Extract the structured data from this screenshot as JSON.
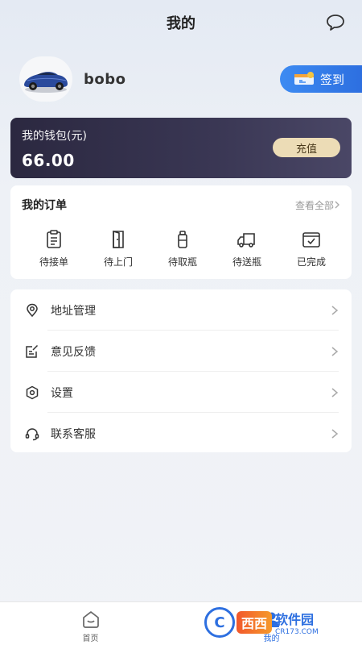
{
  "header": {
    "title": "我的",
    "message_icon": "chat-bubble-icon"
  },
  "profile": {
    "username": "bobo",
    "avatar": "car-avatar"
  },
  "checkin": {
    "label": "签到",
    "icon": "ticket-icon"
  },
  "wallet": {
    "label": "我的钱包(元)",
    "amount": "66.00",
    "recharge_label": "充值"
  },
  "orders": {
    "title": "我的订单",
    "view_all": "查看全部",
    "items": [
      {
        "label": "待接单",
        "icon": "clipboard-icon"
      },
      {
        "label": "待上门",
        "icon": "door-icon"
      },
      {
        "label": "待取瓶",
        "icon": "bottle-icon"
      },
      {
        "label": "待送瓶",
        "icon": "truck-icon"
      },
      {
        "label": "已完成",
        "icon": "check-box-icon"
      }
    ]
  },
  "menu": [
    {
      "label": "地址管理",
      "icon": "location-pin-icon"
    },
    {
      "label": "意见反馈",
      "icon": "feedback-icon"
    },
    {
      "label": "设置",
      "icon": "settings-icon"
    },
    {
      "label": "联系客服",
      "icon": "headset-icon"
    }
  ],
  "tabbar": {
    "tabs": [
      {
        "label": "首页",
        "icon": "home-icon"
      },
      {
        "label": "我的",
        "icon": "profile-icon"
      }
    ],
    "active": "我的"
  },
  "watermark": {
    "logo_text": "西西",
    "name": "软件园",
    "domain": "CR173.COM"
  },
  "colors": {
    "accent": "#2d6fe0",
    "wallet_bg": "#2b2840",
    "recharge_bg": "#ecdcb6"
  }
}
